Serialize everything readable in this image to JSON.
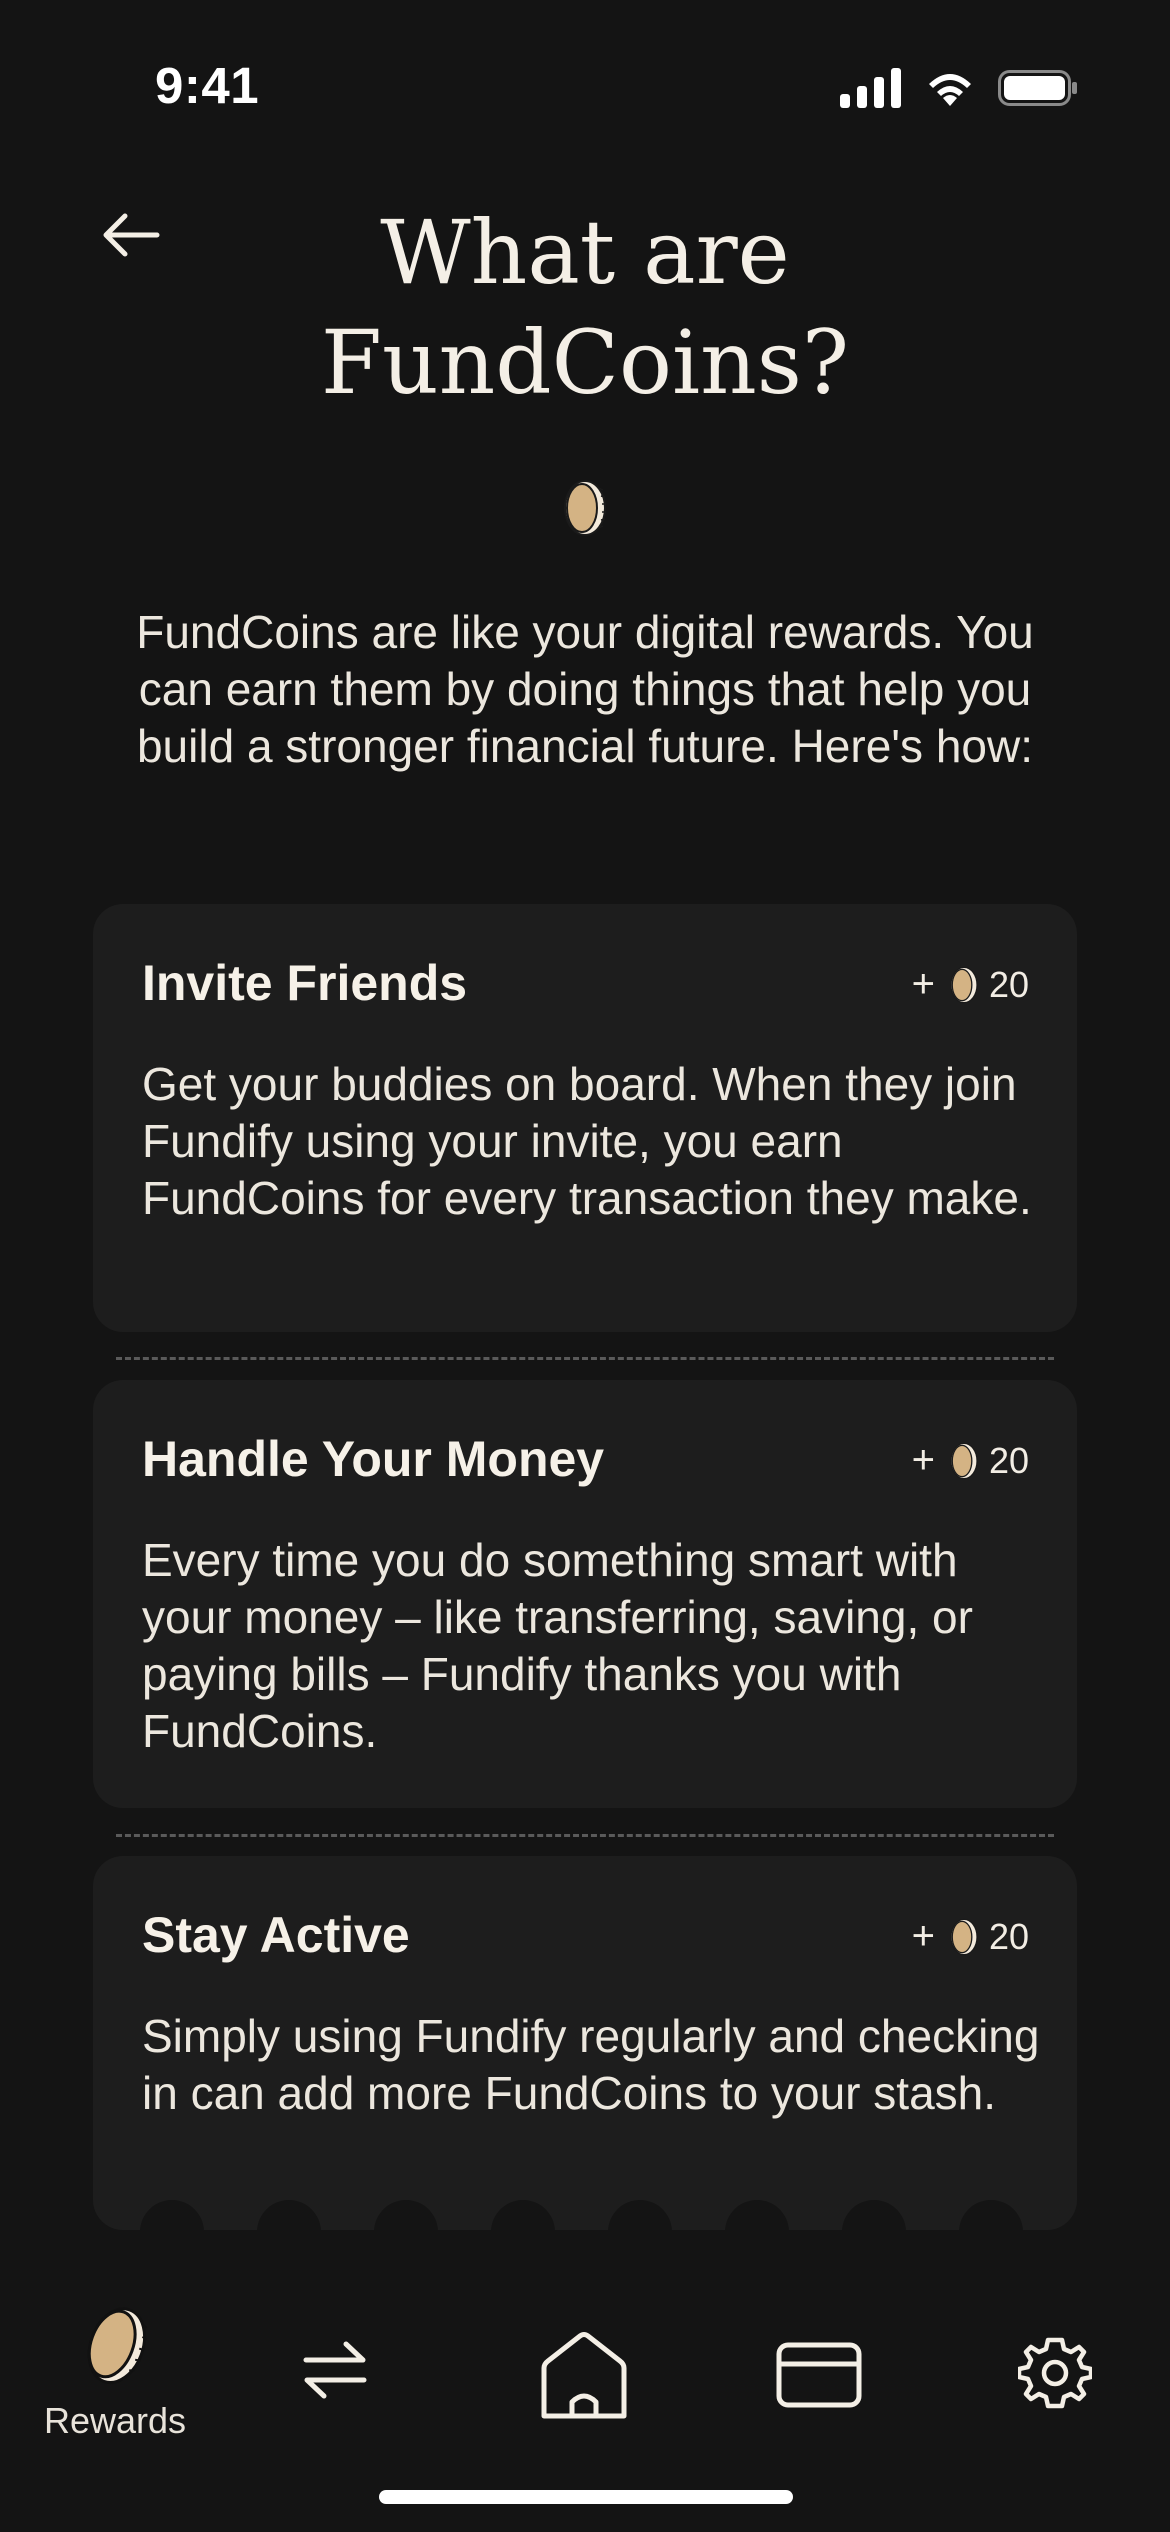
{
  "status": {
    "time": "9:41",
    "icons": [
      "cellular-signal-icon",
      "wifi-icon",
      "battery-icon"
    ]
  },
  "header": {
    "back_icon": "arrow-left-icon",
    "title": "What are FundCoins?"
  },
  "intro": "FundCoins are like your digital rewards. You can earn them by doing things that help you build a stronger financial future. Here's how:",
  "cards": [
    {
      "title": "Invite Friends",
      "plus": "+",
      "amount": "20",
      "description": "Get your buddies on board. When they join Fundify using your invite, you earn FundCoins for every transaction they make."
    },
    {
      "title": "Handle Your Money",
      "plus": "+",
      "amount": "20",
      "description": "Every time you do something smart with your money – like transferring, saving, or paying bills – Fundify thanks you with FundCoins."
    },
    {
      "title": "Stay Active",
      "plus": "+",
      "amount": "20",
      "description": "Simply using Fundify regularly and checking in can add more FundCoins to your stash."
    }
  ],
  "tabbar": {
    "items": [
      {
        "icon": "coin-icon",
        "label": "Rewards",
        "active": true
      },
      {
        "icon": "transfer-arrows-icon",
        "label": ""
      },
      {
        "icon": "home-icon",
        "label": ""
      },
      {
        "icon": "card-icon",
        "label": ""
      },
      {
        "icon": "gear-icon",
        "label": ""
      }
    ]
  },
  "colors": {
    "background": "#141414",
    "card": "#1d1d1d",
    "text": "#f4efe6",
    "coin": "#d4b384",
    "coin_edge": "#f3eadc"
  }
}
